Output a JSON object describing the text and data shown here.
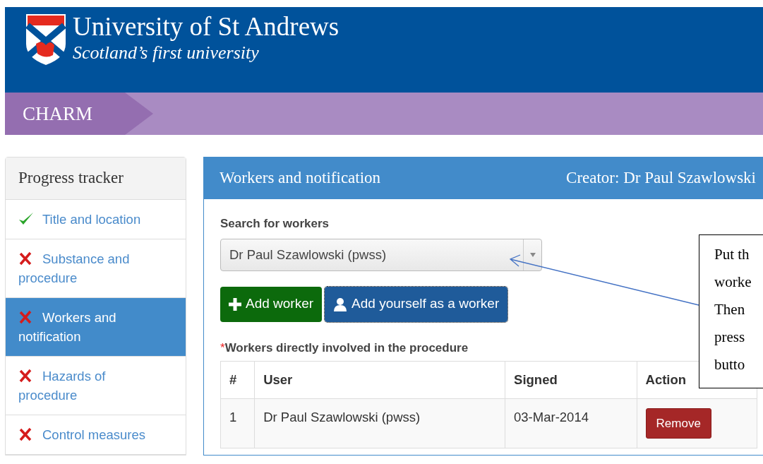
{
  "header": {
    "title": "University of St Andrews",
    "tagline": "Scotland’s first university"
  },
  "app_name": "CHARM",
  "sidebar": {
    "title": "Progress tracker",
    "items": [
      {
        "label": "Title and location",
        "kind": "done",
        "selected": false
      },
      {
        "label": "Substance and procedure",
        "kind": "todo",
        "selected": false
      },
      {
        "label": "Workers and notification",
        "kind": "todo",
        "selected": true
      },
      {
        "label": "Hazards of procedure",
        "kind": "todo",
        "selected": false
      },
      {
        "label": "Control measures",
        "kind": "todo",
        "selected": false
      }
    ]
  },
  "panel": {
    "title": "Workers and notification",
    "creator": "Creator: Dr Paul Szawlowski",
    "search_label": "Search for workers",
    "search_value": "Dr Paul Szawlowski (pwss)",
    "buttons": [
      {
        "label": "Add worker",
        "kind": "add"
      },
      {
        "label": "Add yourself as a worker",
        "kind": "self"
      }
    ],
    "required_mark": "*",
    "table_title": "Workers directly involved in the procedure",
    "table": {
      "columns": [
        "#",
        "User",
        "Signed",
        "Action"
      ],
      "rows": [
        {
          "number": "1",
          "user": "Dr Paul Szawlowski (pwss)",
          "signed": "03-Mar-2014",
          "action": "Remove"
        }
      ]
    }
  },
  "callout": {
    "lines": [
      "Put th",
      "worke",
      "Then",
      "press",
      "butto"
    ]
  }
}
